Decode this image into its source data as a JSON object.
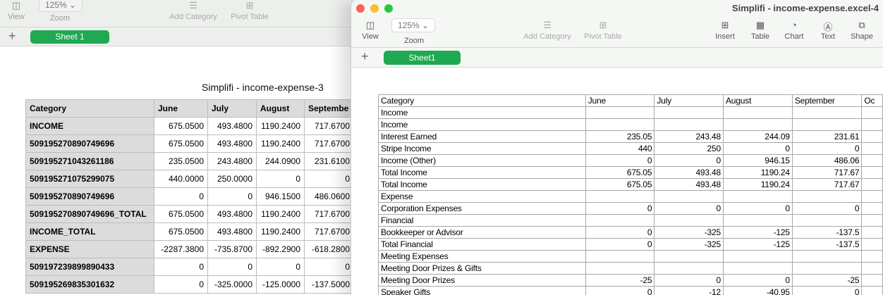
{
  "left_window": {
    "toolbar": {
      "view": "View",
      "zoom_value": "125%",
      "zoom": "Zoom",
      "add_category": "Add Category",
      "pivot_table": "Pivot Table"
    },
    "tab": "Sheet 1",
    "sheet_title": "Simplifi - income-expense-3",
    "columns": [
      "Category",
      "June",
      "July",
      "August",
      "Septembe"
    ],
    "rows": [
      [
        "INCOME",
        "675.0500",
        "493.4800",
        "1190.2400",
        "717.6700"
      ],
      [
        "509195270890749696",
        "675.0500",
        "493.4800",
        "1190.2400",
        "717.6700"
      ],
      [
        "509195271043261186",
        "235.0500",
        "243.4800",
        "244.0900",
        "231.6100"
      ],
      [
        "509195271075299075",
        "440.0000",
        "250.0000",
        "0",
        "0"
      ],
      [
        "509195270890749696",
        "0",
        "0",
        "946.1500",
        "486.0600"
      ],
      [
        "509195270890749696_TOTAL",
        "675.0500",
        "493.4800",
        "1190.2400",
        "717.6700"
      ],
      [
        "INCOME_TOTAL",
        "675.0500",
        "493.4800",
        "1190.2400",
        "717.6700"
      ],
      [
        "EXPENSE",
        "-2287.3800",
        "-735.8700",
        "-892.2900",
        "-618.2800"
      ],
      [
        "509197239899890433",
        "0",
        "0",
        "0",
        "0"
      ],
      [
        "509195269835301632",
        "0",
        "-325.0000",
        "-125.0000",
        "-137.5000"
      ]
    ]
  },
  "right_window": {
    "title": "Simplifi - income-expense.excel-4",
    "toolbar": {
      "view": "View",
      "zoom_value": "125%",
      "zoom": "Zoom",
      "add_category": "Add Category",
      "pivot_table": "Pivot Table",
      "insert": "Insert",
      "table": "Table",
      "chart": "Chart",
      "text": "Text",
      "shape": "Shape"
    },
    "tab": "Sheet1",
    "columns": [
      "Category",
      "June",
      "July",
      "August",
      "September",
      "Oc"
    ],
    "rows": [
      [
        "Income",
        "",
        "",
        "",
        "",
        ""
      ],
      [
        "Income",
        "",
        "",
        "",
        "",
        ""
      ],
      [
        "Interest Earned",
        "235.05",
        "243.48",
        "244.09",
        "231.61",
        ""
      ],
      [
        "Stripe Income",
        "440",
        "250",
        "0",
        "0",
        ""
      ],
      [
        "Income (Other)",
        "0",
        "0",
        "946.15",
        "486.06",
        ""
      ],
      [
        "Total Income",
        "675.05",
        "493.48",
        "1190.24",
        "717.67",
        ""
      ],
      [
        "Total Income",
        "675.05",
        "493.48",
        "1190.24",
        "717.67",
        ""
      ],
      [
        "Expense",
        "",
        "",
        "",
        "",
        ""
      ],
      [
        "Corporation Expenses",
        "0",
        "0",
        "0",
        "0",
        ""
      ],
      [
        "Financial",
        "",
        "",
        "",
        "",
        ""
      ],
      [
        "Bookkeeper or Advisor",
        "0",
        "-325",
        "-125",
        "-137.5",
        ""
      ],
      [
        "Total Financial",
        "0",
        "-325",
        "-125",
        "-137.5",
        ""
      ],
      [
        "Meeting Expenses",
        "",
        "",
        "",
        "",
        ""
      ],
      [
        "Meeting Door Prizes & Gifts",
        "",
        "",
        "",
        "",
        ""
      ],
      [
        "Meeting Door Prizes",
        "-25",
        "0",
        "0",
        "-25",
        ""
      ],
      [
        "Speaker Gifts",
        "0",
        "-12",
        "-40.95",
        "0",
        ""
      ]
    ]
  },
  "colors": {
    "sheet_tab": "#1ea952",
    "toolbar_bg": "#ecefec",
    "close": "#fe5f57",
    "minimize": "#febc2e",
    "maximize": "#28c840"
  }
}
